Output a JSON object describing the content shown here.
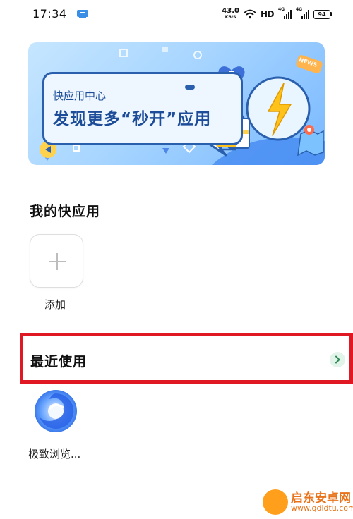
{
  "status_bar": {
    "time": "17:34",
    "net_speed_value": "43.0",
    "net_speed_unit": "KB/S",
    "hd_label": "HD",
    "signal_tag_1": "4G",
    "signal_tag_2": "4G",
    "battery_level": "94"
  },
  "banner": {
    "subtitle": "快应用中心",
    "title": "发现更多“秒开”应用",
    "news_tag": "NEWS"
  },
  "my_apps": {
    "section_title": "我的快应用",
    "add_label": "添加"
  },
  "recent": {
    "section_title": "最近使用",
    "apps": [
      {
        "label": "极致浏览..."
      }
    ]
  },
  "watermark": {
    "main": "启东安卓网",
    "sub": "www.qdldtu.com"
  },
  "colors": {
    "highlight_border": "#e01824",
    "banner_text": "#1d4c98",
    "chevron_bg": "#e2f3e9"
  }
}
